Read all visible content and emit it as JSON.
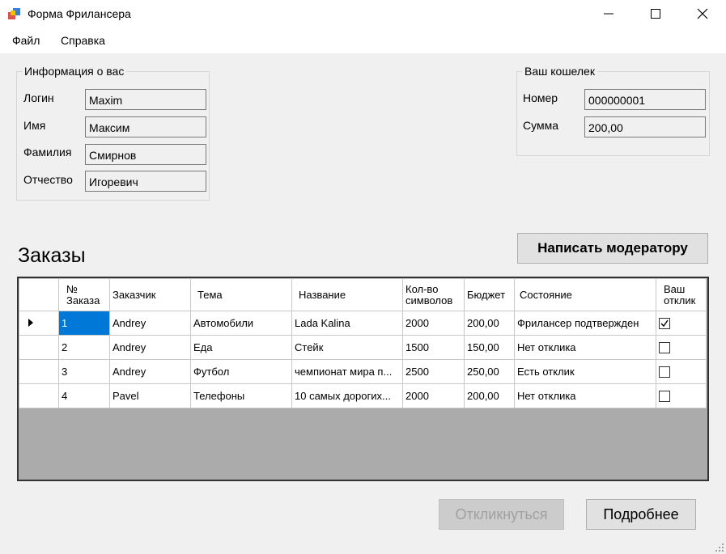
{
  "window": {
    "title": "Форма Фрилансера",
    "icon": "app-window-icon"
  },
  "menu": {
    "items": [
      "Файл",
      "Справка"
    ]
  },
  "info": {
    "legend": "Информация о вас",
    "login_label": "Логин",
    "login_value": "Maxim",
    "name_label": "Имя",
    "name_value": "Максим",
    "surname_label": "Фамилия",
    "surname_value": "Смирнов",
    "patronymic_label": "Отчество",
    "patronymic_value": "Игоревич"
  },
  "wallet": {
    "legend": "Ваш кошелек",
    "number_label": "Номер",
    "number_value": "000000001",
    "sum_label": "Сумма",
    "sum_value": "200,00"
  },
  "moderator_button": "Написать модератору",
  "orders": {
    "title": "Заказы",
    "columns": [
      "№ Заказа",
      "Заказчик",
      "Тема",
      "Название",
      "Кол-во символов",
      "Бюджет",
      "Состояние",
      "Ваш отклик"
    ],
    "rows": [
      {
        "num": "1",
        "customer": "Andrey",
        "topic": "Автомобили",
        "name": "Lada Kalina",
        "chars": "2000",
        "budget": "200,00",
        "status": "Фрилансер подтвержден",
        "response": true
      },
      {
        "num": "2",
        "customer": "Andrey",
        "topic": "Еда",
        "name": "Стейк",
        "chars": "1500",
        "budget": "150,00",
        "status": "Нет отклика",
        "response": false
      },
      {
        "num": "3",
        "customer": "Andrey",
        "topic": "Футбол",
        "name": "чемпионат мира п...",
        "chars": "2500",
        "budget": "250,00",
        "status": "Есть отклик",
        "response": false
      },
      {
        "num": "4",
        "customer": "Pavel",
        "topic": "Телефоны",
        "name": "10 самых дорогих...",
        "chars": "2000",
        "budget": "200,00",
        "status": "Нет отклика",
        "response": false
      }
    ]
  },
  "buttons": {
    "respond": "Откликнуться",
    "details": "Подробнее"
  },
  "colors": {
    "selection": "#0078d7",
    "grid_background": "#ababab",
    "disabled_text": "#a0a0a0"
  }
}
